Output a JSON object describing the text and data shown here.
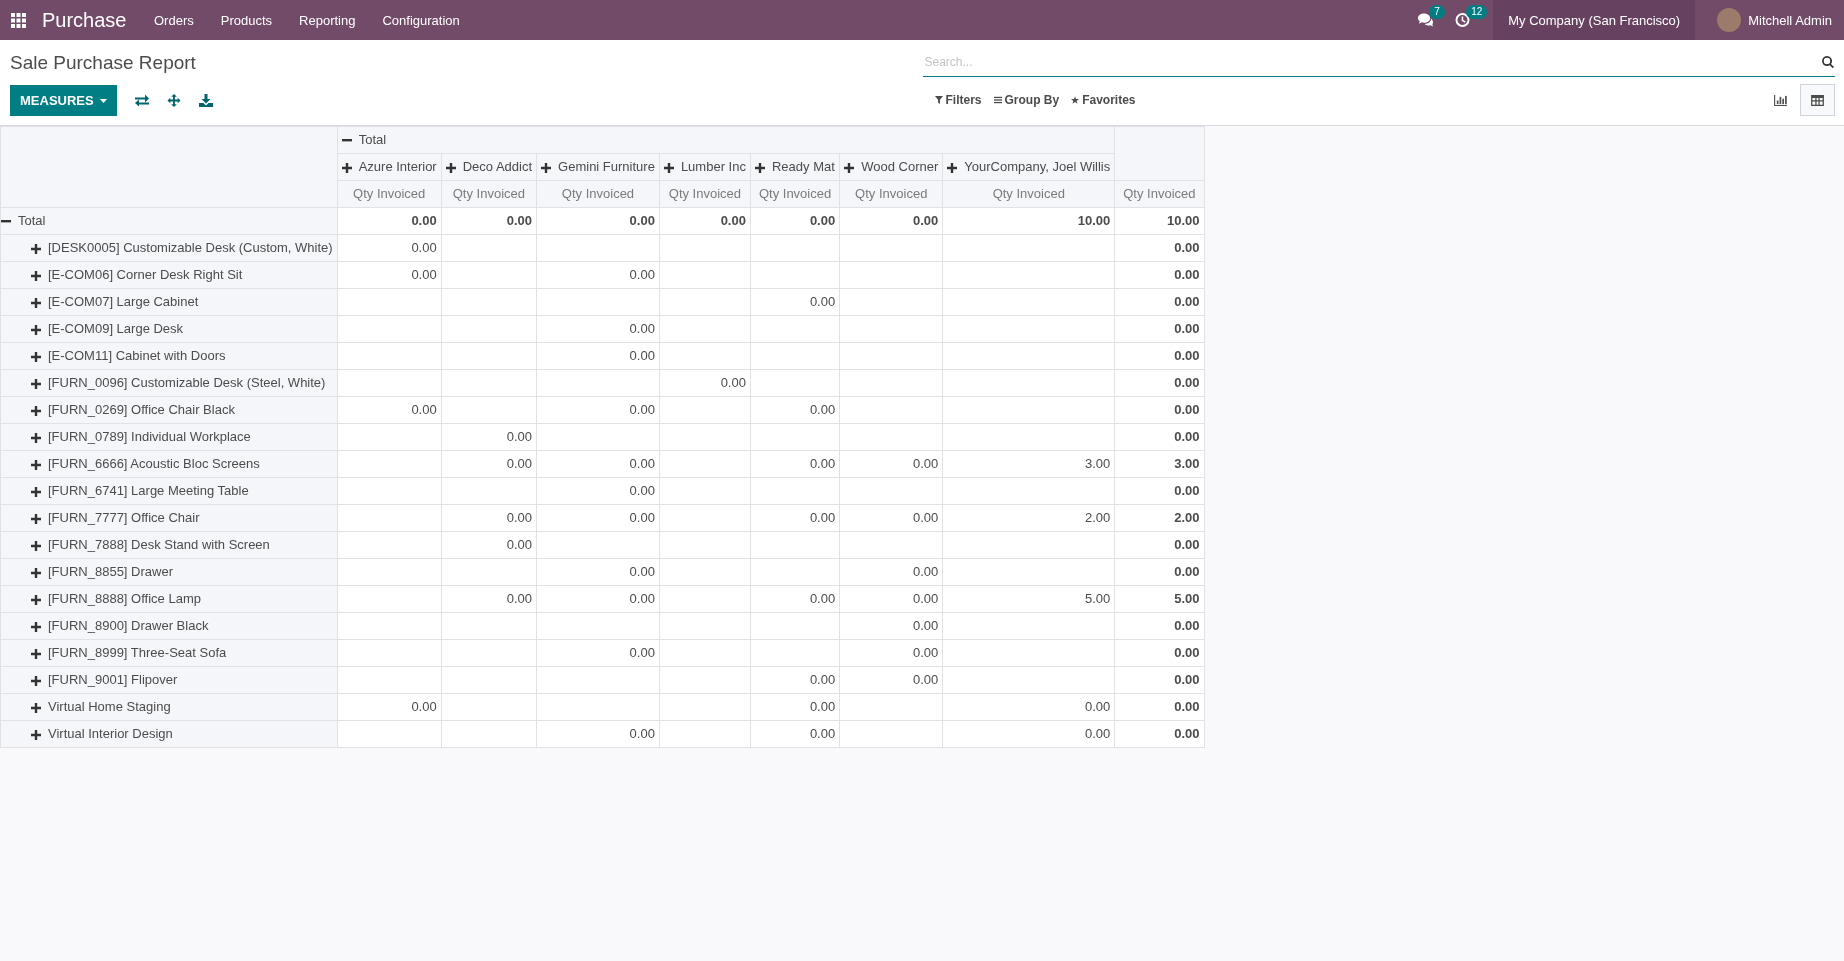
{
  "navbar": {
    "app_name": "Purchase",
    "menu": [
      "Orders",
      "Products",
      "Reporting",
      "Configuration"
    ],
    "messages_badge": "7",
    "activities_badge": "12",
    "company": "My Company (San Francisco)",
    "user": "Mitchell Admin"
  },
  "control_panel": {
    "title": "Sale Purchase Report",
    "measures_button": "MEASURES",
    "search": {
      "placeholder": "Search..."
    },
    "search_options": [
      {
        "kind": "filters",
        "label": "Filters"
      },
      {
        "kind": "group_by",
        "label": "Group By"
      },
      {
        "kind": "favorites",
        "label": "Favorites"
      }
    ],
    "views": [
      {
        "kind": "graph",
        "selected": false
      },
      {
        "kind": "pivot",
        "selected": true
      }
    ]
  },
  "pivot": {
    "column_group": {
      "label": "Total",
      "expanded": true
    },
    "columns": [
      {
        "label": "Azure Interior",
        "expanded": false
      },
      {
        "label": "Deco Addict",
        "expanded": false
      },
      {
        "label": "Gemini Furniture",
        "expanded": false
      },
      {
        "label": "Lumber Inc",
        "expanded": false
      },
      {
        "label": "Ready Mat",
        "expanded": false
      },
      {
        "label": "Wood Corner",
        "expanded": false
      },
      {
        "label": "YourCompany, Joel Willis",
        "expanded": false
      }
    ],
    "measure_headers": [
      "Qty Invoiced",
      "Qty Invoiced",
      "Qty Invoiced",
      "Qty Invoiced",
      "Qty Invoiced",
      "Qty Invoiced",
      "Qty Invoiced",
      "Qty Invoiced"
    ],
    "total_row": {
      "label": "Total",
      "expanded": true,
      "cells": [
        "0.00",
        "0.00",
        "0.00",
        "0.00",
        "0.00",
        "0.00",
        "10.00"
      ],
      "total": "10.00"
    },
    "rows": [
      {
        "label": "[DESK0005] Customizable Desk (Custom, White)",
        "expanded": false,
        "cells": [
          "0.00",
          null,
          null,
          null,
          null,
          null,
          null
        ],
        "total": "0.00"
      },
      {
        "label": "[E-COM06] Corner Desk Right Sit",
        "expanded": false,
        "cells": [
          "0.00",
          null,
          "0.00",
          null,
          null,
          null,
          null
        ],
        "total": "0.00"
      },
      {
        "label": "[E-COM07] Large Cabinet",
        "expanded": false,
        "cells": [
          null,
          null,
          null,
          null,
          "0.00",
          null,
          null
        ],
        "total": "0.00"
      },
      {
        "label": "[E-COM09] Large Desk",
        "expanded": false,
        "cells": [
          null,
          null,
          "0.00",
          null,
          null,
          null,
          null
        ],
        "total": "0.00"
      },
      {
        "label": "[E-COM11] Cabinet with Doors",
        "expanded": false,
        "cells": [
          null,
          null,
          "0.00",
          null,
          null,
          null,
          null
        ],
        "total": "0.00"
      },
      {
        "label": "[FURN_0096] Customizable Desk (Steel, White)",
        "expanded": false,
        "cells": [
          null,
          null,
          null,
          "0.00",
          null,
          null,
          null
        ],
        "total": "0.00"
      },
      {
        "label": "[FURN_0269] Office Chair Black",
        "expanded": false,
        "cells": [
          "0.00",
          null,
          "0.00",
          null,
          "0.00",
          null,
          null
        ],
        "total": "0.00"
      },
      {
        "label": "[FURN_0789] Individual Workplace",
        "expanded": false,
        "cells": [
          null,
          "0.00",
          null,
          null,
          null,
          null,
          null
        ],
        "total": "0.00"
      },
      {
        "label": "[FURN_6666] Acoustic Bloc Screens",
        "expanded": false,
        "cells": [
          null,
          "0.00",
          "0.00",
          null,
          "0.00",
          "0.00",
          "3.00"
        ],
        "total": "3.00"
      },
      {
        "label": "[FURN_6741] Large Meeting Table",
        "expanded": false,
        "cells": [
          null,
          null,
          "0.00",
          null,
          null,
          null,
          null
        ],
        "total": "0.00"
      },
      {
        "label": "[FURN_7777] Office Chair",
        "expanded": false,
        "cells": [
          null,
          "0.00",
          "0.00",
          null,
          "0.00",
          "0.00",
          "2.00"
        ],
        "total": "2.00"
      },
      {
        "label": "[FURN_7888] Desk Stand with Screen",
        "expanded": false,
        "cells": [
          null,
          "0.00",
          null,
          null,
          null,
          null,
          null
        ],
        "total": "0.00"
      },
      {
        "label": "[FURN_8855] Drawer",
        "expanded": false,
        "cells": [
          null,
          null,
          "0.00",
          null,
          null,
          "0.00",
          null
        ],
        "total": "0.00"
      },
      {
        "label": "[FURN_8888] Office Lamp",
        "expanded": false,
        "cells": [
          null,
          "0.00",
          "0.00",
          null,
          "0.00",
          "0.00",
          "5.00"
        ],
        "total": "5.00"
      },
      {
        "label": "[FURN_8900] Drawer Black",
        "expanded": false,
        "cells": [
          null,
          null,
          null,
          null,
          null,
          "0.00",
          null
        ],
        "total": "0.00"
      },
      {
        "label": "[FURN_8999] Three-Seat Sofa",
        "expanded": false,
        "cells": [
          null,
          null,
          "0.00",
          null,
          null,
          "0.00",
          null
        ],
        "total": "0.00"
      },
      {
        "label": "[FURN_9001] Flipover",
        "expanded": false,
        "cells": [
          null,
          null,
          null,
          null,
          "0.00",
          "0.00",
          null
        ],
        "total": "0.00"
      },
      {
        "label": "Virtual Home Staging",
        "expanded": false,
        "cells": [
          "0.00",
          null,
          null,
          null,
          "0.00",
          null,
          "0.00"
        ],
        "total": "0.00"
      },
      {
        "label": "Virtual Interior Design",
        "expanded": false,
        "cells": [
          null,
          null,
          "0.00",
          null,
          "0.00",
          null,
          "0.00"
        ],
        "total": "0.00"
      }
    ]
  }
}
